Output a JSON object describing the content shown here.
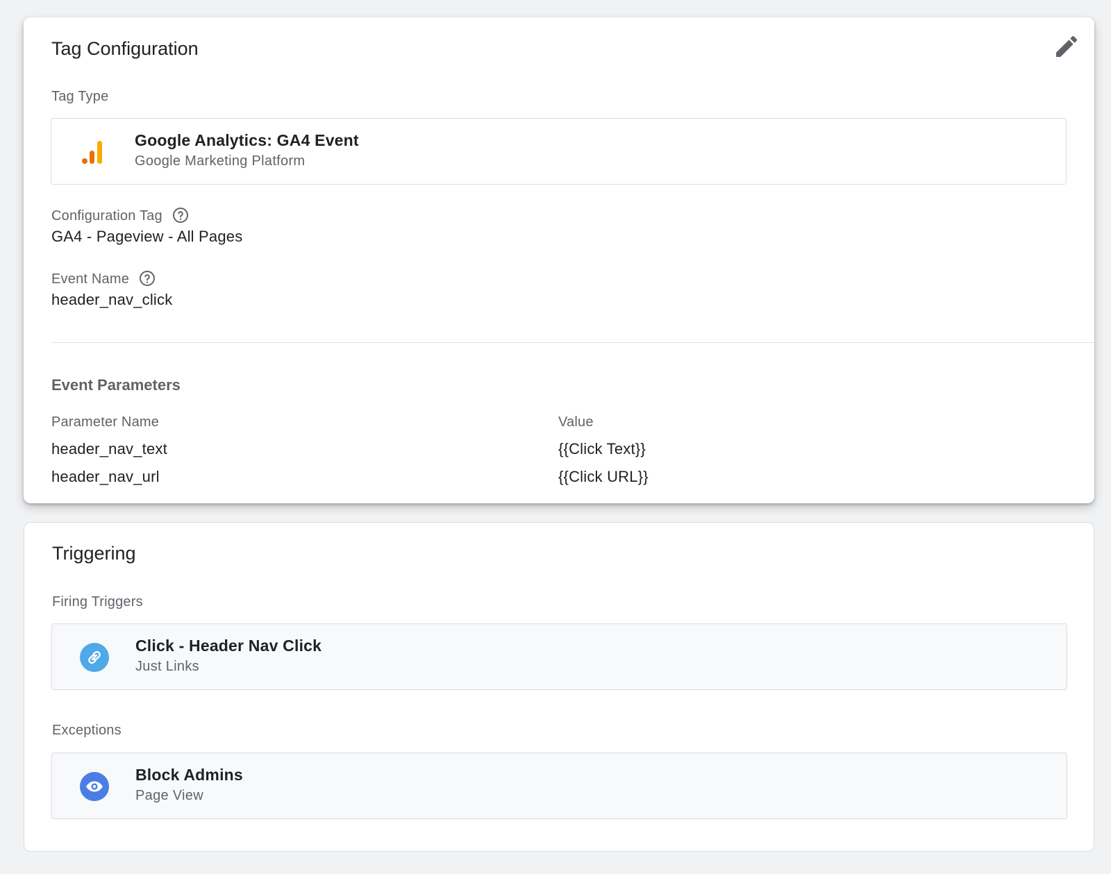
{
  "tag_configuration": {
    "title": "Tag Configuration",
    "tag_type_label": "Tag Type",
    "tag_type": {
      "name": "Google Analytics: GA4 Event",
      "provider": "Google Marketing Platform",
      "icon": "analytics-bars-icon"
    },
    "config_tag_label": "Configuration Tag",
    "config_tag_value": "GA4 - Pageview - All Pages",
    "event_name_label": "Event Name",
    "event_name_value": "header_nav_click",
    "event_parameters": {
      "heading": "Event Parameters",
      "col_name": "Parameter Name",
      "col_value": "Value",
      "rows": [
        {
          "name": "header_nav_text",
          "value": "{{Click Text}}"
        },
        {
          "name": "header_nav_url",
          "value": "{{Click URL}}"
        }
      ]
    }
  },
  "triggering": {
    "title": "Triggering",
    "firing_label": "Firing Triggers",
    "firing_trigger": {
      "name": "Click - Header Nav Click",
      "type": "Just Links",
      "icon": "link-icon",
      "icon_color": "#4fa9e8"
    },
    "exceptions_label": "Exceptions",
    "exception": {
      "name": "Block Admins",
      "type": "Page View",
      "icon": "eye-icon",
      "icon_color": "#4a7ee5"
    }
  }
}
